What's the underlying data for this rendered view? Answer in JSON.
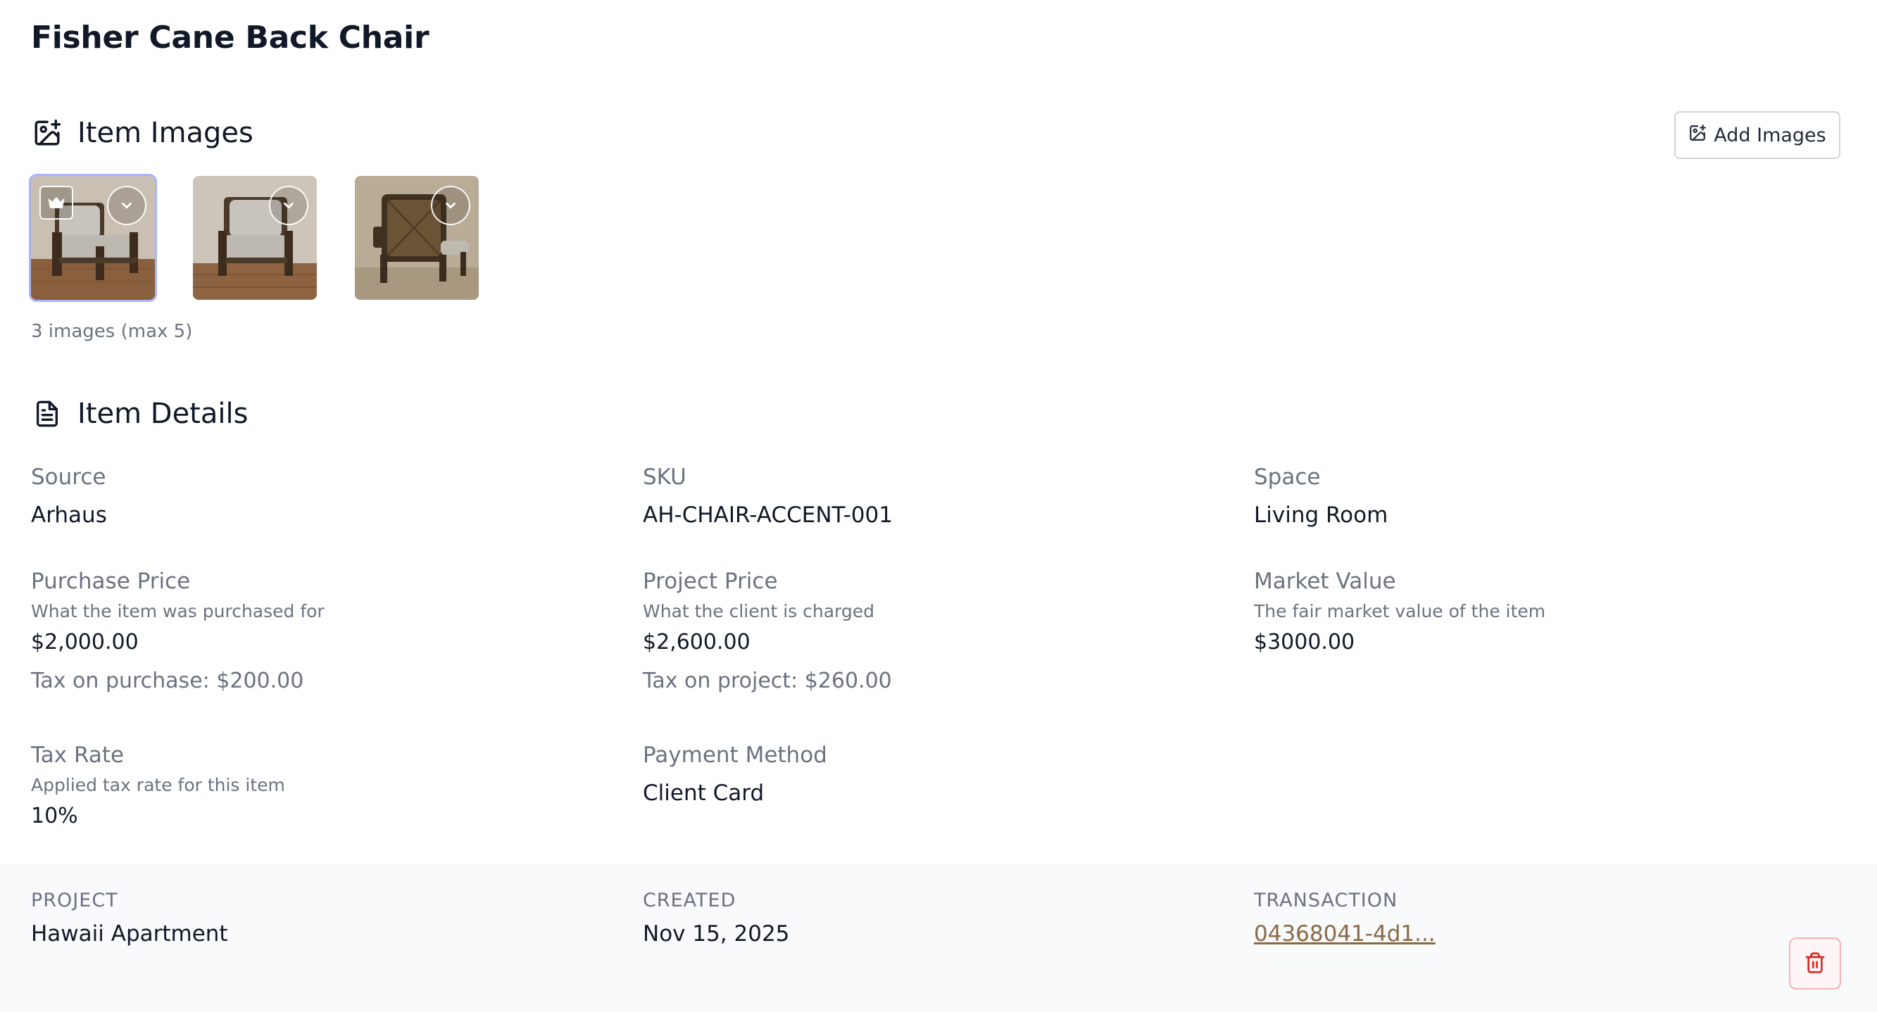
{
  "page": {
    "title": "Fisher Cane Back Chair"
  },
  "images_section": {
    "title": "Item Images",
    "icon": "image-plus-icon",
    "add_button_label": "Add Images",
    "count_text": "3 images (max 5)",
    "thumbnails": [
      {
        "name": "chair-front-angle",
        "primary": true
      },
      {
        "name": "chair-front",
        "primary": false
      },
      {
        "name": "chair-back",
        "primary": false
      }
    ]
  },
  "details_section": {
    "title": "Item Details",
    "icon": "file-text-icon",
    "source": {
      "label": "Source",
      "value": "Arhaus"
    },
    "sku": {
      "label": "SKU",
      "value": "AH-CHAIR-ACCENT-001"
    },
    "space": {
      "label": "Space",
      "value": "Living Room"
    },
    "purchase_price": {
      "label": "Purchase Price",
      "help": "What the item was purchased for",
      "value": "$2,000.00",
      "tax": "Tax on purchase: $200.00"
    },
    "project_price": {
      "label": "Project Price",
      "help": "What the client is charged",
      "value": "$2,600.00",
      "tax": "Tax on project: $260.00"
    },
    "market_value": {
      "label": "Market Value",
      "help": "The fair market value of the item",
      "value": "$3000.00"
    },
    "tax_rate": {
      "label": "Tax Rate",
      "help": "Applied tax rate for this item",
      "value": "10%"
    },
    "payment_method": {
      "label": "Payment Method",
      "value": "Client Card"
    }
  },
  "footer": {
    "project": {
      "label": "PROJECT",
      "value": "Hawaii Apartment"
    },
    "created": {
      "label": "CREATED",
      "value": "Nov 15, 2025"
    },
    "transaction": {
      "label": "TRANSACTION",
      "value": "04368041-4d1..."
    }
  },
  "colors": {
    "link": "#8a6a45",
    "primary_outline": "#a5b4fc",
    "danger": "#dc2626"
  }
}
